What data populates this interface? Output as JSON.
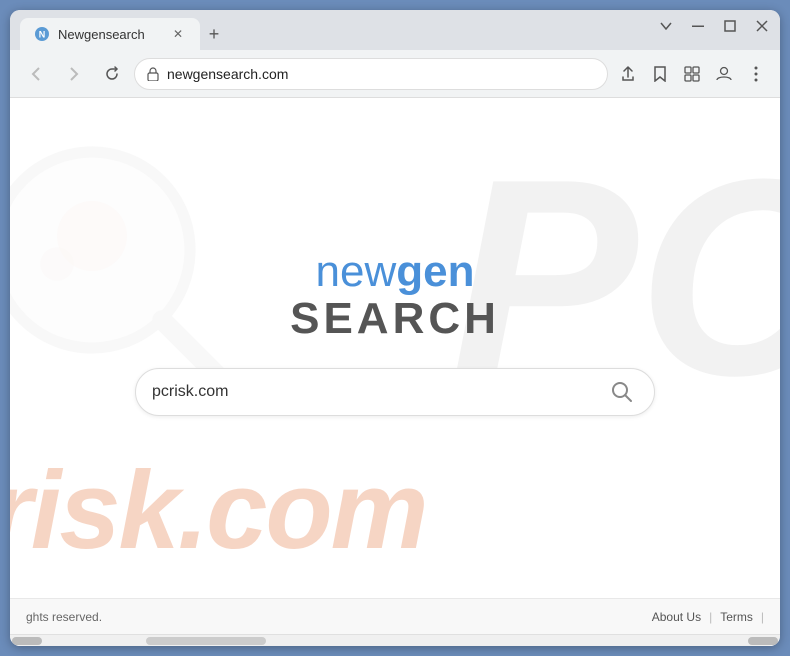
{
  "browser": {
    "tab": {
      "title": "Newgensearch",
      "favicon": "🔵"
    },
    "new_tab_label": "+",
    "window_controls": {
      "chevron": "∨",
      "minimize": "—",
      "maximize": "□",
      "close": "✕"
    },
    "address_bar": {
      "url": "newgensearch.com",
      "lock_icon": "🔒"
    },
    "toolbar_icons": {
      "back": "←",
      "forward": "→",
      "refresh": "↺",
      "share": "⬆",
      "bookmark": "☆",
      "extensions": "□",
      "profile": "👤",
      "menu": "⋮"
    }
  },
  "page": {
    "brand": {
      "new": "new",
      "gen": "gen",
      "search": "SEARCH"
    },
    "search": {
      "placeholder": "pcrisk.com",
      "value": "pcrisk.com",
      "button_label": "🔍"
    },
    "footer": {
      "copyright": "ghts reserved.",
      "about_us": "About Us",
      "terms": "Terms",
      "divider1": "|",
      "divider2": "|"
    },
    "watermark": {
      "pc": "PC",
      "risk": "risk.com"
    }
  }
}
